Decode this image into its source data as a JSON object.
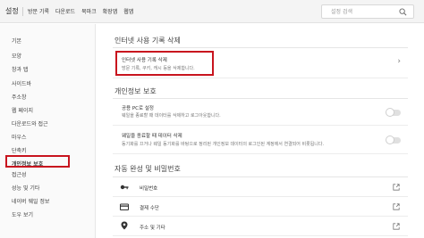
{
  "header": {
    "title": "설정",
    "tabs": [
      "방문 기록",
      "다운로드",
      "북마크",
      "확장앱",
      "웹앱"
    ],
    "search_placeholder": "설정 검색"
  },
  "sidebar": {
    "items": [
      "기본",
      "모양",
      "창과 탭",
      "사이드바",
      "주소창",
      "웹 페이지",
      "다운로드와 접근",
      "마우스",
      "단축키",
      "개인정보 보호",
      "접근성",
      "성능 및 기타",
      "네이버 웨일 정보",
      "도우 보기"
    ],
    "active_index": 9
  },
  "main": {
    "section_history": {
      "title": "인터넷 사용 기록 삭제",
      "row": {
        "title": "인터넷 사용 기록 삭제",
        "subtitle": "방문 기록, 쿠키, 캐시 등을 삭제합니다."
      }
    },
    "section_privacy": {
      "title": "개인정보 보호",
      "rows": [
        {
          "title": "공용 PC로 설정",
          "subtitle": "웨일을 종료할 때 데이터를 삭제하고 로그아웃합니다."
        },
        {
          "title": "웨일을 종료할 때 데이터 삭제",
          "subtitle": "동기화를 끄거나 웨일 동기화를 바탕으로 정리된 개인정보 데이터의 로그인된 계정에서 연결되어 비롯됩니다."
        }
      ]
    },
    "section_autofill": {
      "title": "자동 완성 및 비밀번호",
      "rows": [
        {
          "icon": "key-icon",
          "label": "비밀번호"
        },
        {
          "icon": "credit-card-icon",
          "label": "결제 수단"
        },
        {
          "icon": "location-pin-icon",
          "label": "주소 및 기타"
        }
      ]
    }
  },
  "colors": {
    "highlight": "#c8141e",
    "accent": "#333333"
  }
}
